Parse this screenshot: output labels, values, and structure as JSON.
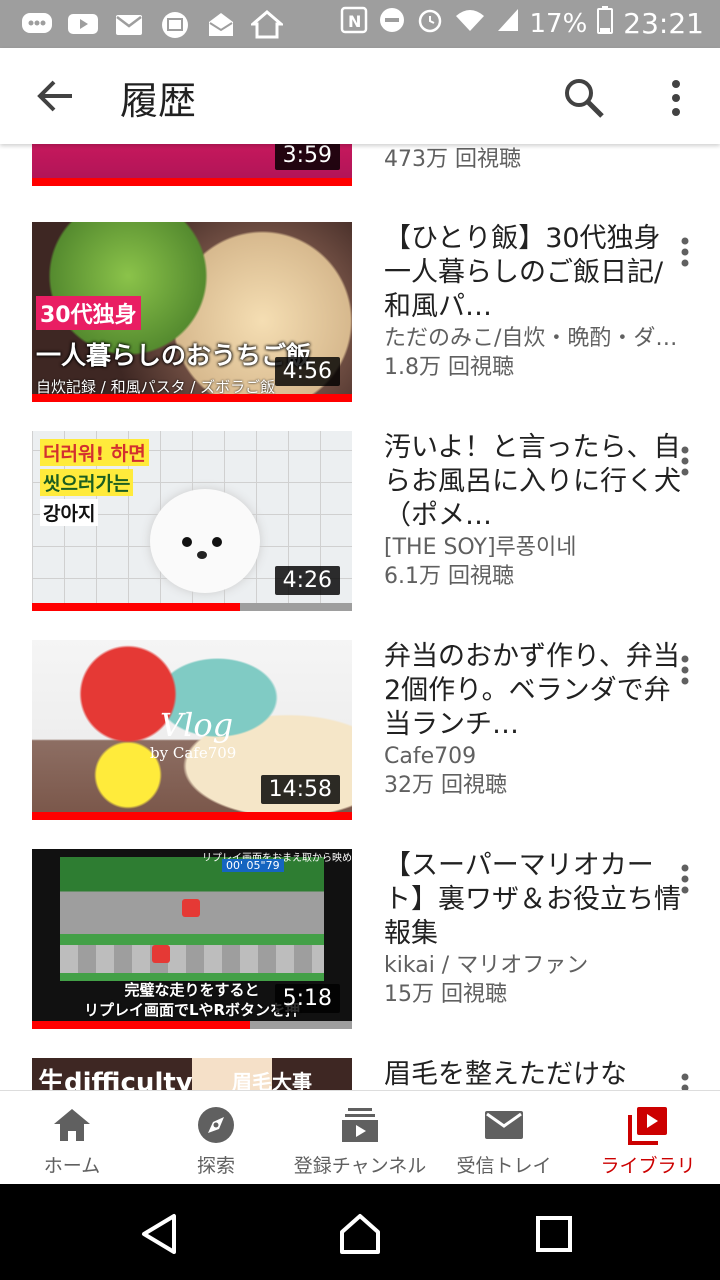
{
  "status_bar": {
    "battery": "17%",
    "time": "23:21"
  },
  "app_bar": {
    "title": "履歴"
  },
  "videos": [
    {
      "title": "",
      "channel": "",
      "views": "473万 回視聴",
      "duration": "3:59",
      "progress": 1.0
    },
    {
      "title": "【ひとり飯】30代独身一人暮らしのご飯日記/和風パ…",
      "channel": "ただのみこ/自炊・晩酌・ダ…",
      "views": "1.8万 回視聴",
      "duration": "4:56",
      "progress": 1.0,
      "thumb_text": [
        "30代独身",
        "一人暮らしのおうちご飯",
        "自炊記録 / 和風パスタ / ズボラご飯"
      ]
    },
    {
      "title": "汚いよ！と言ったら、自らお風呂に入りに行く犬（ポメ…",
      "channel": "[THE SOY]루퐁이네",
      "views": "6.1万 回視聴",
      "duration": "4:26",
      "progress": 0.65,
      "thumb_text": [
        "더러워! 하면",
        "씻으러가는",
        "강아지"
      ]
    },
    {
      "title": "弁当のおかず作り、弁当2個作り。ベランダで弁当ランチ…",
      "channel": "Cafe709",
      "views": "32万 回視聴",
      "duration": "14:58",
      "progress": 1.0,
      "thumb_text": [
        "Vlog",
        "by Cafe709"
      ]
    },
    {
      "title": "【スーパーマリオカート】裏ワザ＆お役立ち情報集",
      "channel": "kikai / マリオファン",
      "views": "15万 回視聴",
      "duration": "5:18",
      "progress": 0.68,
      "thumb_text": [
        "リプレイ画面をおまえ取から映める",
        "00' 05\"79",
        "完璧な走りをすると",
        "リプレイ画面でLやRボタンを押"
      ]
    },
    {
      "title": "眉毛を整えただけな",
      "channel": "",
      "views": "",
      "duration": "",
      "progress": 0,
      "thumb_text": [
        "生difficulty",
        "眉毛大事"
      ]
    }
  ],
  "bottom_nav": [
    {
      "label": "ホーム",
      "icon": "home-icon"
    },
    {
      "label": "探索",
      "icon": "explore-icon"
    },
    {
      "label": "登録チャンネル",
      "icon": "subscriptions-icon"
    },
    {
      "label": "受信トレイ",
      "icon": "inbox-icon"
    },
    {
      "label": "ライブラリ",
      "icon": "library-icon",
      "active": true
    }
  ],
  "colors": {
    "accent": "#ff0000",
    "active_tab": "#cc0000",
    "status_bar": "#9e9e9e"
  }
}
